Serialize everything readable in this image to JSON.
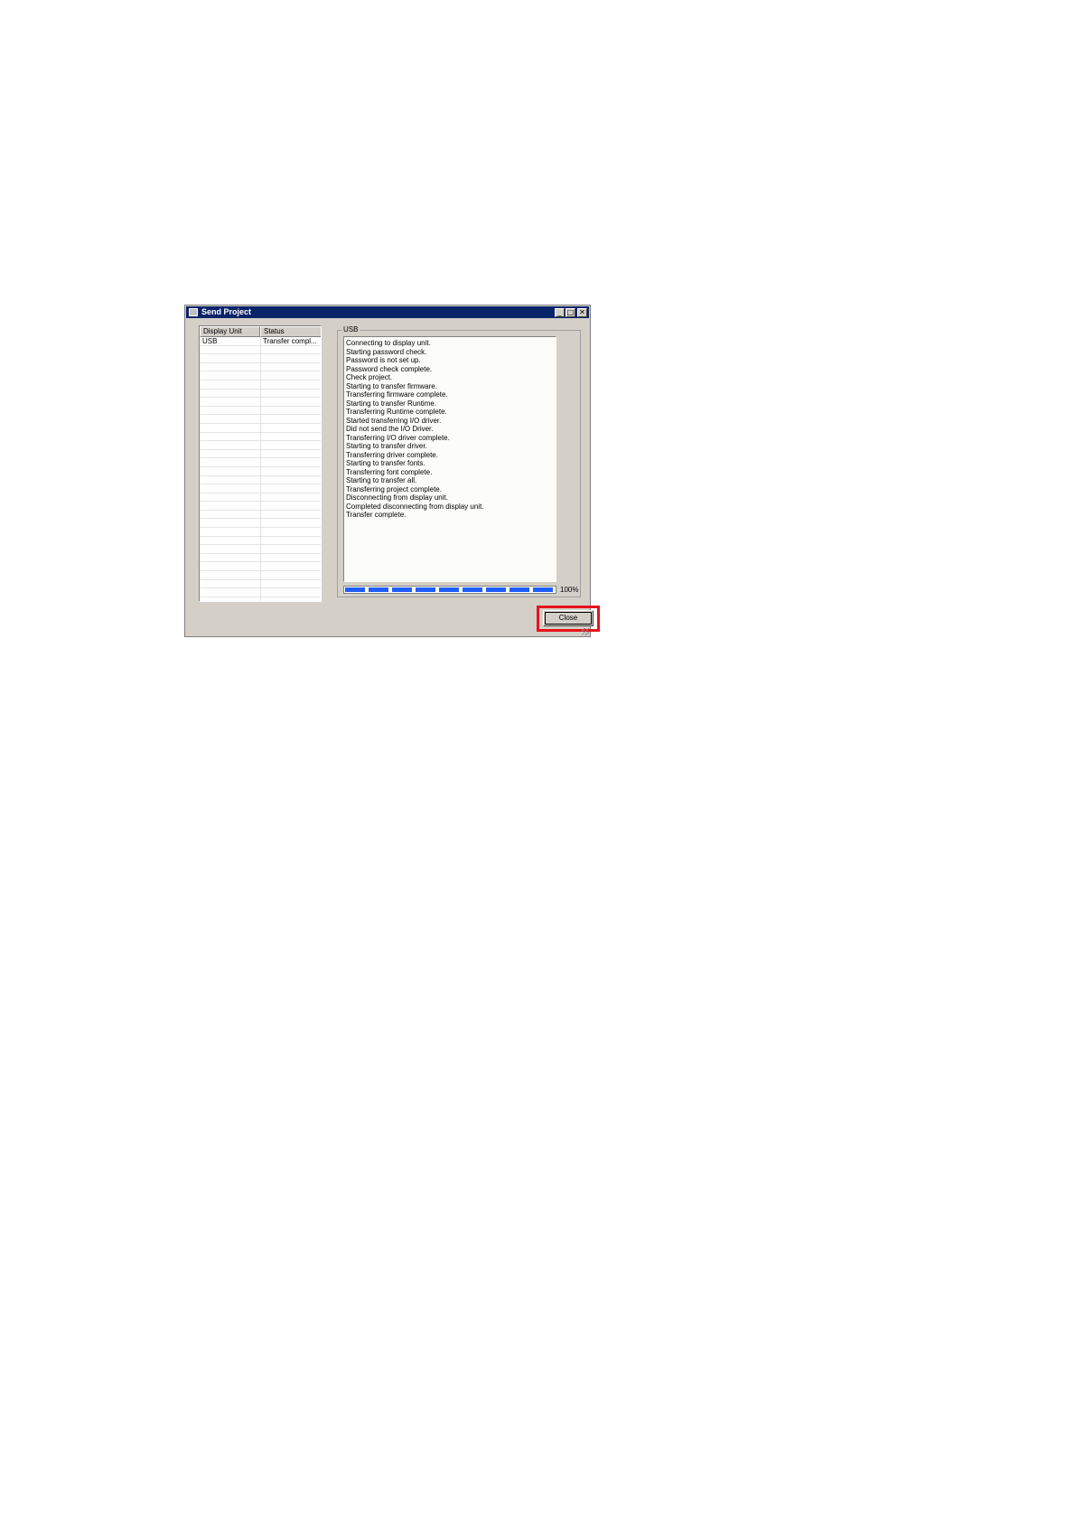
{
  "window": {
    "title": "Send Project",
    "controls": {
      "minimize": "_",
      "maximize": "□",
      "close": "✕"
    }
  },
  "unit_list": {
    "columns": [
      "Display Unit",
      "Status"
    ],
    "rows": [
      {
        "display_unit": "USB",
        "status": "Transfer compl..."
      }
    ]
  },
  "transfer_panel": {
    "group_label": "USB",
    "log": [
      "Connecting to display unit.",
      "Starting password check.",
      "Password is not set up.",
      "Password check complete.",
      "Check project.",
      "Starting to transfer firmware.",
      "Transferring firmware complete.",
      "Starting to transfer Runtime.",
      "Transferring Runtime complete.",
      "Started transferring I/O driver.",
      "Did not send the I/O Driver.",
      "Transferring I/O driver complete.",
      "Starting to transfer driver.",
      "Transferring driver complete.",
      "Starting to transfer fonts.",
      "Transferring font complete.",
      "Starting to transfer all.",
      "Transferring project complete.",
      "Disconnecting from display unit.",
      "Completed disconnecting from display unit.",
      "Transfer complete."
    ],
    "progress_fraction": 1.0,
    "progress_label": "100%"
  },
  "buttons": {
    "close_label": "Close"
  },
  "colors": {
    "titlebar": "#0a246a",
    "progress": "#1e5eff",
    "highlight": "#e8141c",
    "dialog_face": "#d4d0c8"
  }
}
